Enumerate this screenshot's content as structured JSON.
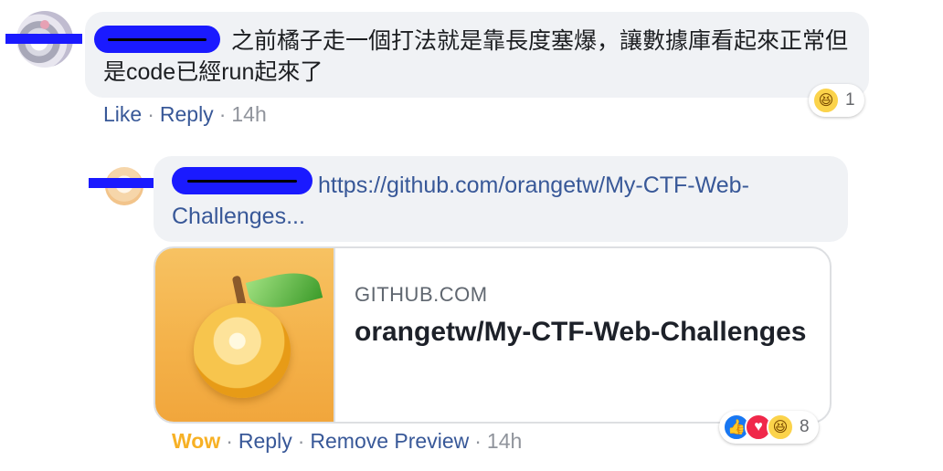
{
  "comment1": {
    "text": "之前橘子走一個打法就是靠長度塞爆，讓數據庫看起來正常但是code已經run起來了",
    "actions": {
      "like": "Like",
      "reply": "Reply",
      "time": "14h"
    },
    "reactions": {
      "icons": [
        "haha-icon"
      ],
      "count": "1"
    }
  },
  "comment2": {
    "link": "https://github.com/orangetw/My-CTF-Web-Challenges...",
    "preview": {
      "domain": "GITHUB.COM",
      "title": "orangetw/My-CTF-Web-Challenges"
    },
    "actions": {
      "wow": "Wow",
      "reply": "Reply",
      "remove_preview": "Remove Preview",
      "time": "14h"
    },
    "reactions": {
      "icons": [
        "like-icon",
        "love-icon",
        "haha-icon"
      ],
      "count": "8"
    }
  },
  "separator": "·",
  "colors": {
    "bubble": "#f0f2f5",
    "link": "#385898",
    "wow": "#f7b125",
    "redaction": "#1a1aff"
  }
}
